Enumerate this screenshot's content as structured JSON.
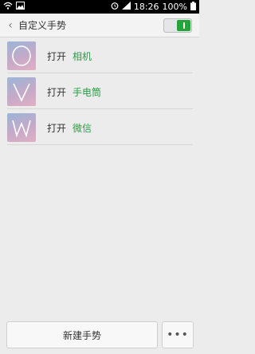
{
  "status_bar": {
    "time": "18:26",
    "battery": "100%",
    "icons": [
      "wifi-icon",
      "image-icon",
      "alarm-icon",
      "signal-icon",
      "battery-icon"
    ]
  },
  "header": {
    "back_icon": "back-chevron-icon",
    "title": "自定义手势",
    "toggle_state": "on"
  },
  "gestures": [
    {
      "shape": "O",
      "action": "打开",
      "app": "相机"
    },
    {
      "shape": "V",
      "action": "打开",
      "app": "手电筒"
    },
    {
      "shape": "W",
      "action": "打开",
      "app": "微信"
    }
  ],
  "bottom": {
    "new_label": "新建手势",
    "more_label": "•••"
  },
  "colors": {
    "accent_green": "#2a9d45",
    "background": "#ececec"
  }
}
